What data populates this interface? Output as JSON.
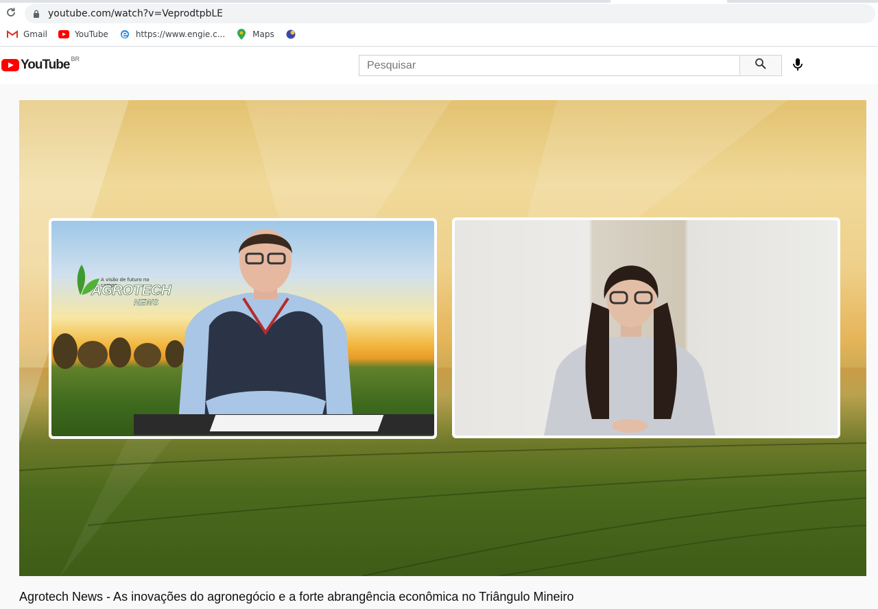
{
  "browser": {
    "url": "youtube.com/watch?v=VeprodtpbLE",
    "bookmarks": [
      {
        "label": "Gmail",
        "icon": "gmail-icon"
      },
      {
        "label": "YouTube",
        "icon": "youtube-icon"
      },
      {
        "label": "https://www.engie.c...",
        "icon": "edge-icon"
      },
      {
        "label": "Maps",
        "icon": "maps-pin-icon"
      },
      {
        "label": "",
        "icon": "globe-extension-icon"
      }
    ]
  },
  "masthead": {
    "logo_text": "YouTube",
    "country_code": "BR",
    "search_placeholder": "Pesquisar"
  },
  "video": {
    "show_logo_tagline": "A visão de futuro no campo",
    "show_logo_main": "AGROTECH",
    "show_logo_sub": "NEWS"
  },
  "video_title": "Agrotech News - As inovações do agronegócio e a forte abrangência econômica no Triângulo Mineiro",
  "colors": {
    "youtube_red": "#ff0000",
    "page_bg": "#f9f9f9"
  }
}
